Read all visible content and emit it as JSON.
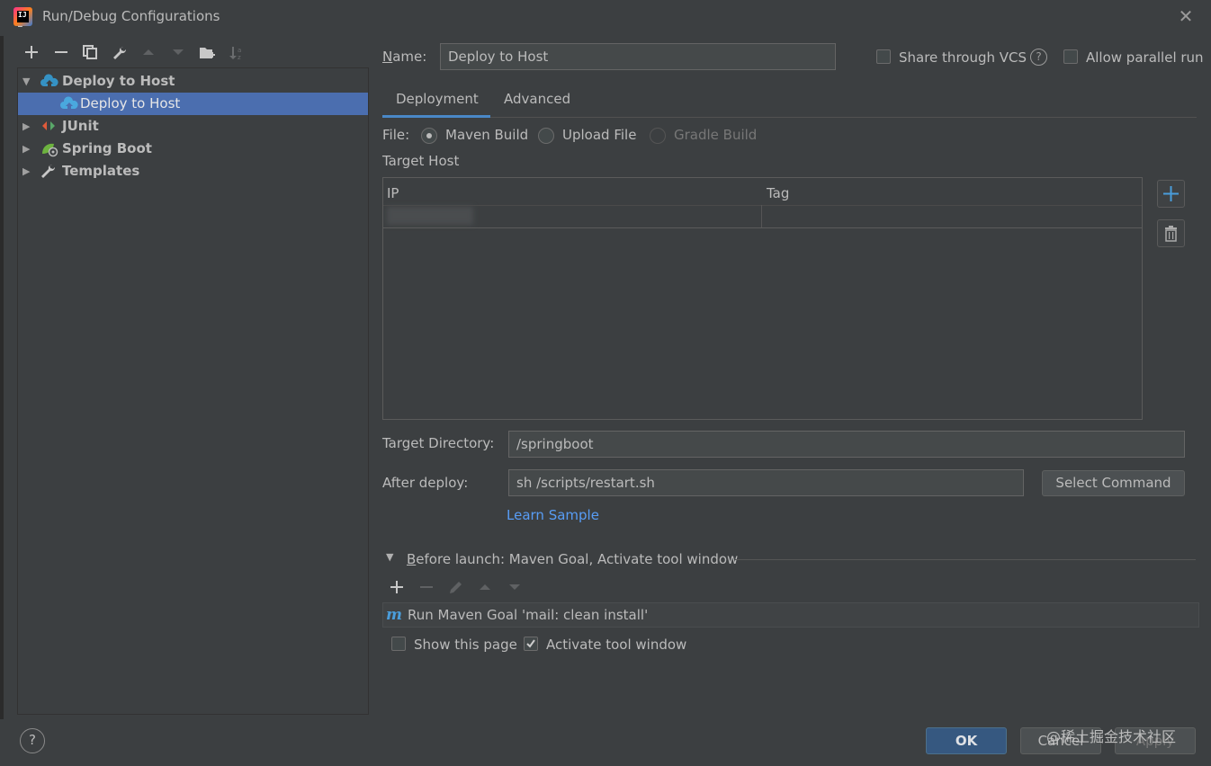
{
  "window": {
    "title": "Run/Debug Configurations"
  },
  "tree": {
    "items": [
      {
        "label": "Deploy to Host",
        "bold": true,
        "expanded": true
      },
      {
        "label": "Deploy to Host",
        "bold": false,
        "selected": true
      },
      {
        "label": "JUnit",
        "bold": true
      },
      {
        "label": "Spring Boot",
        "bold": true
      },
      {
        "label": "Templates",
        "bold": true
      }
    ]
  },
  "form": {
    "name_label": "Name:",
    "name_value": "Deploy to Host",
    "share_vcs_label": "Share through VCS",
    "allow_parallel_label": "Allow parallel run",
    "tabs": [
      {
        "label": "Deployment",
        "active": true
      },
      {
        "label": "Advanced",
        "active": false
      }
    ],
    "file_label": "File:",
    "file_options": [
      {
        "label": "Maven Build",
        "selected": true,
        "disabled": false
      },
      {
        "label": "Upload File",
        "selected": false,
        "disabled": false
      },
      {
        "label": "Gradle Build",
        "selected": false,
        "disabled": true
      }
    ],
    "target_host_label": "Target Host",
    "table_columns": [
      "IP",
      "Tag"
    ],
    "target_directory_label": "Target Directory:",
    "target_directory_value": "/springboot",
    "after_deploy_label": "After deploy:",
    "after_deploy_value": "sh /scripts/restart.sh",
    "select_command_label": "Select Command",
    "learn_sample_label": "Learn Sample",
    "before_launch_label": "Before launch: Maven Goal, Activate tool window",
    "before_launch_task": "Run Maven Goal 'mail: clean install'",
    "show_page_label": "Show this page",
    "activate_tool_window_label": "Activate tool window",
    "activate_tool_window_checked": true,
    "show_page_checked": false
  },
  "buttons": {
    "ok": "OK",
    "cancel": "Cancel",
    "apply": "Apply",
    "help": "?"
  },
  "watermark": "@稀土掘金技术社区",
  "colors": {
    "background": "#3c3f41",
    "selection": "#4b6eaf",
    "accent": "#4a88c7",
    "link": "#589df6",
    "primary_button": "#365880"
  }
}
